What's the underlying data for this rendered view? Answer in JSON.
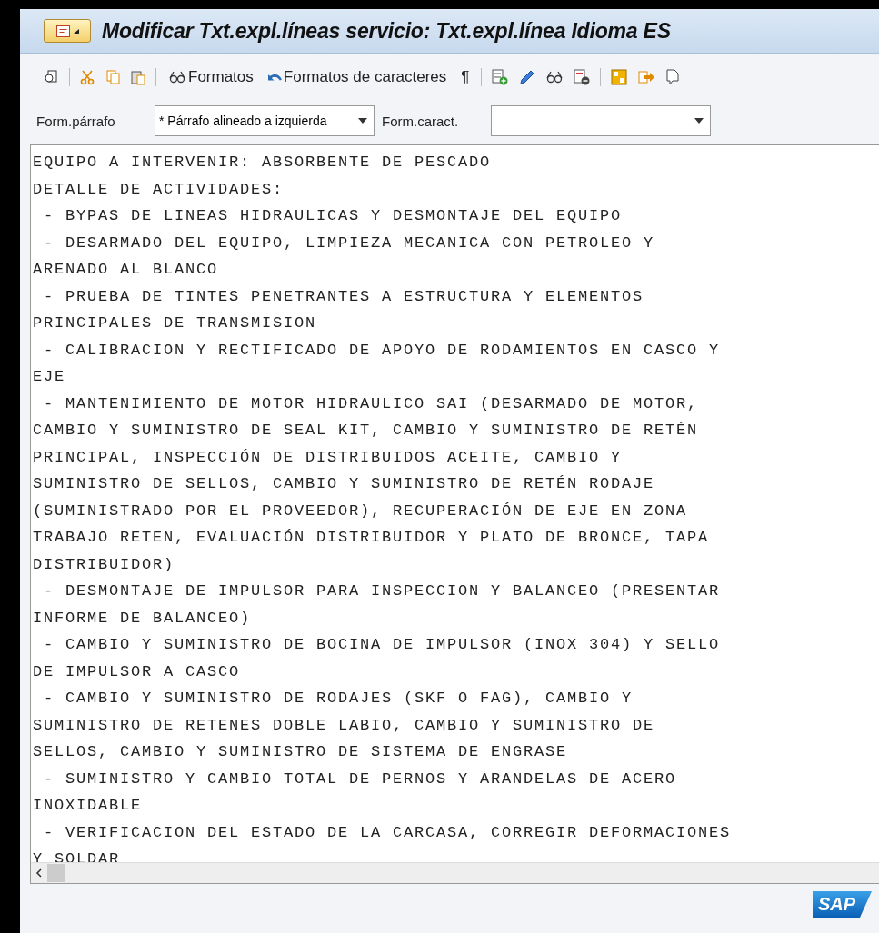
{
  "window": {
    "title": "Modificar Txt.expl.líneas servicio: Txt.expl.línea Idioma ES"
  },
  "toolbar": {
    "buttons": [
      {
        "label": "Formatos"
      },
      {
        "label": "Formatos de caracteres"
      },
      {
        "label": "¶"
      }
    ]
  },
  "format_bar": {
    "paragraph_label": "Form.párrafo",
    "paragraph_value": "* Párrafo alineado a izquierda",
    "char_label": "Form.caract."
  },
  "editor": {
    "lines": [
      "EQUIPO A INTERVENIR: ABSORBENTE DE PESCADO",
      "DETALLE DE ACTIVIDADES:",
      " - BYPAS DE LINEAS HIDRAULICAS Y DESMONTAJE DEL EQUIPO",
      " - DESARMADO DEL EQUIPO, LIMPIEZA MECANICA CON PETROLEO Y",
      "ARENADO AL BLANCO",
      " - PRUEBA DE TINTES PENETRANTES A ESTRUCTURA Y ELEMENTOS",
      "PRINCIPALES DE TRANSMISION",
      " - CALIBRACION Y RECTIFICADO DE APOYO DE RODAMIENTOS EN CASCO Y",
      "EJE",
      " - MANTENIMIENTO DE MOTOR HIDRAULICO SAI (DESARMADO DE MOTOR,",
      "CAMBIO Y SUMINISTRO DE SEAL KIT, CAMBIO Y SUMINISTRO DE RETÉN",
      "PRINCIPAL, INSPECCIÓN DE DISTRIBUIDOS ACEITE, CAMBIO Y",
      "SUMINISTRO DE SELLOS, CAMBIO Y SUMINISTRO DE RETÉN RODAJE",
      "(SUMINISTRADO POR EL PROVEEDOR), RECUPERACIÓN DE EJE EN ZONA",
      "TRABAJO RETEN, EVALUACIÓN DISTRIBUIDOR Y PLATO DE BRONCE, TAPA",
      "DISTRIBUIDOR)",
      " - DESMONTAJE DE IMPULSOR PARA INSPECCION Y BALANCEO (PRESENTAR",
      "INFORME DE BALANCEO)",
      " - CAMBIO Y SUMINISTRO DE BOCINA DE IMPULSOR (INOX 304) Y SELLO",
      "DE IMPULSOR A CASCO",
      " - CAMBIO Y SUMINISTRO DE RODAJES (SKF O FAG), CAMBIO Y",
      "SUMINISTRO DE RETENES DOBLE LABIO, CAMBIO Y SUMINISTRO DE",
      "SELLOS, CAMBIO Y SUMINISTRO DE SISTEMA DE ENGRASE",
      " - SUMINISTRO Y CAMBIO TOTAL DE PERNOS Y ARANDELAS DE ACERO",
      "INOXIDABLE",
      " - VERIFICACION DEL ESTADO DE LA CARCASA, CORREGIR DEFORMACIONES",
      "Y SOLDAR"
    ]
  },
  "logo": {
    "text": "SAP"
  }
}
